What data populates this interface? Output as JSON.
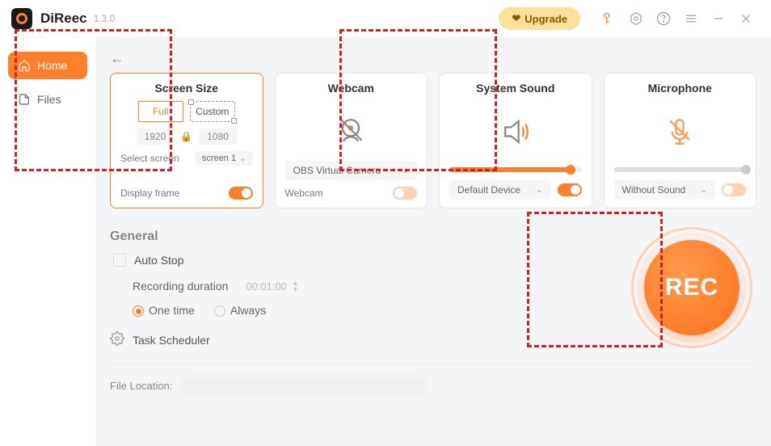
{
  "titlebar": {
    "app_name": "DiReec",
    "version": "1.3.0",
    "upgrade_label": "Upgrade"
  },
  "sidebar": {
    "home": "Home",
    "files": "Files"
  },
  "cards": {
    "screen": {
      "title": "Screen Size",
      "full": "Full",
      "custom": "Custom",
      "width": "1920",
      "height": "1080",
      "select_label": "Select screen",
      "select_value": "screen 1",
      "display_frame": "Display frame"
    },
    "webcam": {
      "title": "Webcam",
      "device": "OBS Virtual Camera",
      "label": "Webcam"
    },
    "system": {
      "title": "System Sound",
      "device": "Default Device",
      "volume_pct": 92
    },
    "mic": {
      "title": "Microphone",
      "device": "Without Sound",
      "volume_pct": 100
    }
  },
  "general": {
    "title": "General",
    "auto_stop": "Auto Stop",
    "rec_duration": "Recording duration",
    "time_value": "00:01:00",
    "one_time": "One time",
    "always": "Always",
    "task_scheduler": "Task Scheduler",
    "file_location": "File Location:"
  },
  "rec": {
    "label": "REC"
  }
}
